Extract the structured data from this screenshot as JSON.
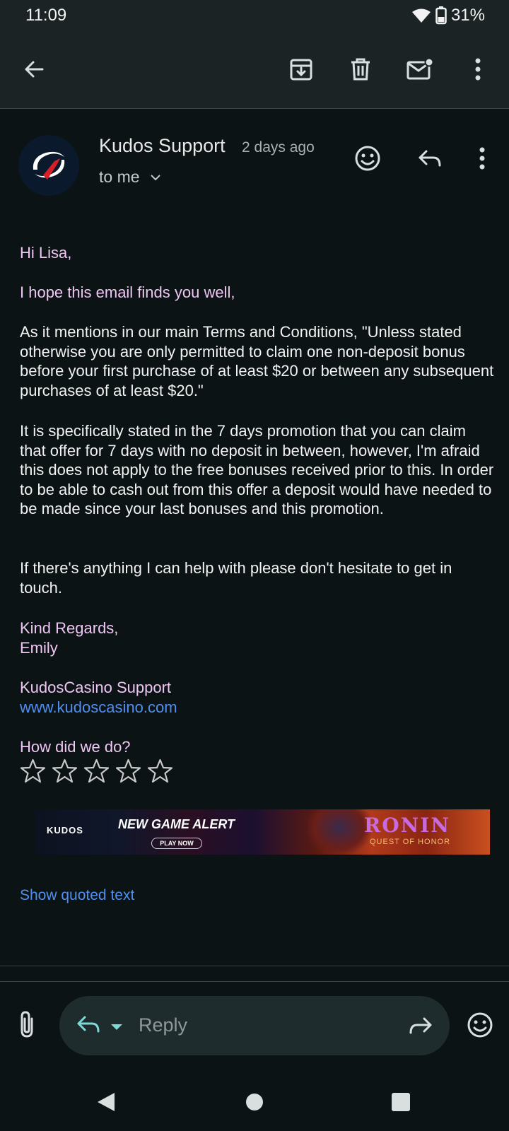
{
  "status_bar": {
    "time": "11:09",
    "battery": "31%"
  },
  "toolbar": {
    "back_icon": "arrow-left-icon",
    "archive_icon": "archive-icon",
    "delete_icon": "trash-icon",
    "mark_unread_icon": "mail-unread-icon",
    "more_icon": "more-vert-icon"
  },
  "email": {
    "sender": "Kudos Support",
    "time": "2 days ago",
    "recipient": "to me",
    "body": {
      "greeting": "Hi Lisa,",
      "opening": "I hope this email finds you well,",
      "paragraph1": "As it mentions in our main Terms and Conditions, \"Unless stated otherwise you are only permitted to claim one non-deposit bonus before your first purchase of at least $20 or between any subsequent purchases of at least $20.\"",
      "paragraph2": "It is specifically stated in the 7 days promotion that you can claim that offer for 7 days with no deposit in between, however, I'm afraid this does not apply to the free bonuses received prior to this. In order to be able to cash out from this offer a deposit would have needed to be made since your last bonuses and this promotion.",
      "paragraph3": "If there's anything I can help with please don't hesitate to get in touch.",
      "signoff": "Kind Regards,",
      "signer": "Emily",
      "org": "KudosCasino Support",
      "website": "www.kudoscasino.com",
      "feedback_prompt": "How did we do?",
      "rating": {
        "value": 0,
        "max": 5
      }
    },
    "banner": {
      "logo": "KUDOS",
      "headline": "NEW GAME ALERT",
      "cta": "PLAY NOW",
      "game_title": "RONIN",
      "game_subtitle": "QUEST OF HONOR"
    },
    "show_quoted": "Show quoted text"
  },
  "reply_bar": {
    "attach_icon": "paperclip-icon",
    "reply_icon": "reply-icon",
    "placeholder": "Reply",
    "forward_icon": "forward-icon",
    "emoji_icon": "emoji-icon"
  },
  "colors": {
    "background": "#0c1314",
    "toolbar": "#1b2324",
    "pink_text": "#efc6f3",
    "link": "#4f8ff0",
    "reply_accent": "#7fd8d8"
  }
}
